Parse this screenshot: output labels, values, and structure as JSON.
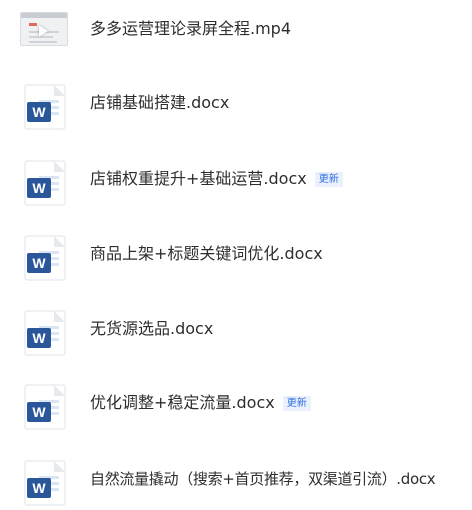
{
  "files": [
    {
      "name": "多多运营理论录屏全程.mp4",
      "type": "video",
      "icon": "video-thumbnail-icon",
      "badge": ""
    },
    {
      "name": "店铺基础搭建.docx",
      "type": "word",
      "icon": "word-doc-icon",
      "badge": ""
    },
    {
      "name": "店铺权重提升+基础运营.docx",
      "type": "word",
      "icon": "word-doc-icon",
      "badge": "更新"
    },
    {
      "name": "商品上架+标题关键词优化.docx",
      "type": "word",
      "icon": "word-doc-icon",
      "badge": ""
    },
    {
      "name": "无货源选品.docx",
      "type": "word",
      "icon": "word-doc-icon",
      "badge": ""
    },
    {
      "name": "优化调整+稳定流量.docx",
      "type": "word",
      "icon": "word-doc-icon",
      "badge": "更新"
    },
    {
      "name": "自然流量撬动（搜索+首页推荐，双渠道引流）.docx",
      "type": "word",
      "icon": "word-doc-icon",
      "badge": ""
    }
  ],
  "colors": {
    "word_blue": "#2b579a",
    "word_light": "#dbe6f5",
    "badge_text": "#2f6fe0",
    "badge_bg": "#eaf1fd"
  }
}
